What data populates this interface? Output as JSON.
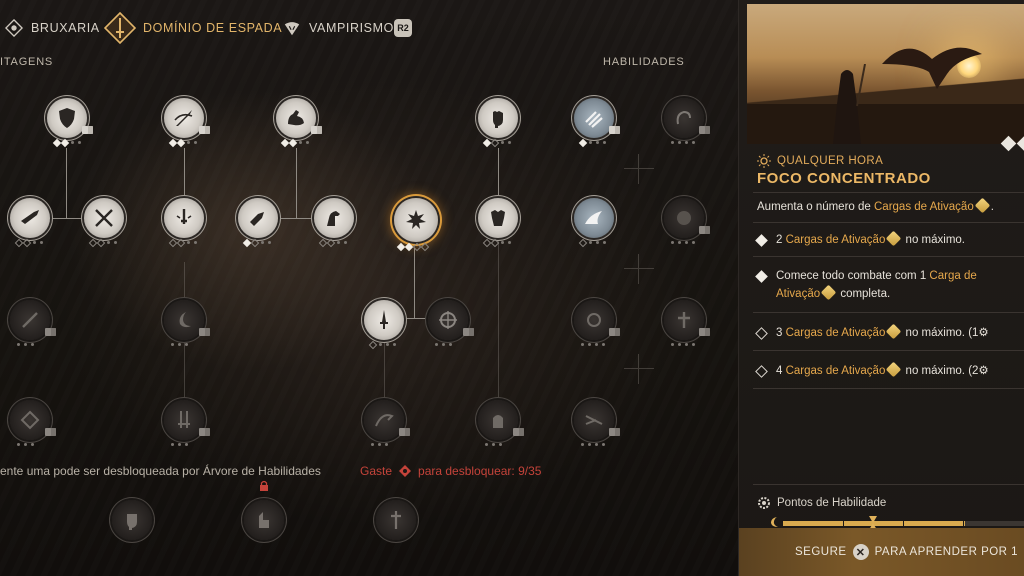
{
  "nav": {
    "tabs": [
      {
        "label": "Bruxaria",
        "icon": "witchcraft-icon"
      },
      {
        "label": "Domínio de Espada",
        "icon": "sword-mastery-icon"
      },
      {
        "label": "Vampirismo",
        "icon": "vampirism-icon"
      }
    ],
    "badge": "R2"
  },
  "sections": {
    "left": "ITAGENS",
    "right": "HABILIDADES"
  },
  "tree": {
    "note": "ente uma pode ser desbloqueada por Árvore de Habilidades",
    "spend_prefix": "Gaste",
    "spend_suffix": "para desbloquear: 9/35"
  },
  "detail": {
    "time_label": "QUALQUER HORA",
    "title": "FOCO CONCENTRADO",
    "description_prefix": "Aumenta o número de",
    "description_highlight": "Cargas de Ativação",
    "description_suffix": ".",
    "tiers": [
      {
        "state": "unlocked",
        "pre": "2",
        "hl": "Cargas de Ativação",
        "post": "no máximo.",
        "extra": ""
      },
      {
        "state": "unlocked",
        "pre": "Comece todo combate com 1",
        "hl": "Carga de Ativação",
        "post": "completa.",
        "extra": ""
      },
      {
        "state": "locked",
        "pre": "3",
        "hl": "Cargas de Ativação",
        "post": "no máximo.",
        "extra": "(1"
      },
      {
        "state": "locked",
        "pre": "4",
        "hl": "Cargas de Ativação",
        "post": "no máximo.",
        "extra": "(2"
      }
    ],
    "points_label": "Pontos de Habilidade",
    "points_progress": 0.75
  },
  "footer": {
    "hold": "SEGURE",
    "action": "PARA APRENDER POR 1"
  },
  "colors": {
    "accent": "#e6a84c",
    "warning": "#c4433a"
  }
}
